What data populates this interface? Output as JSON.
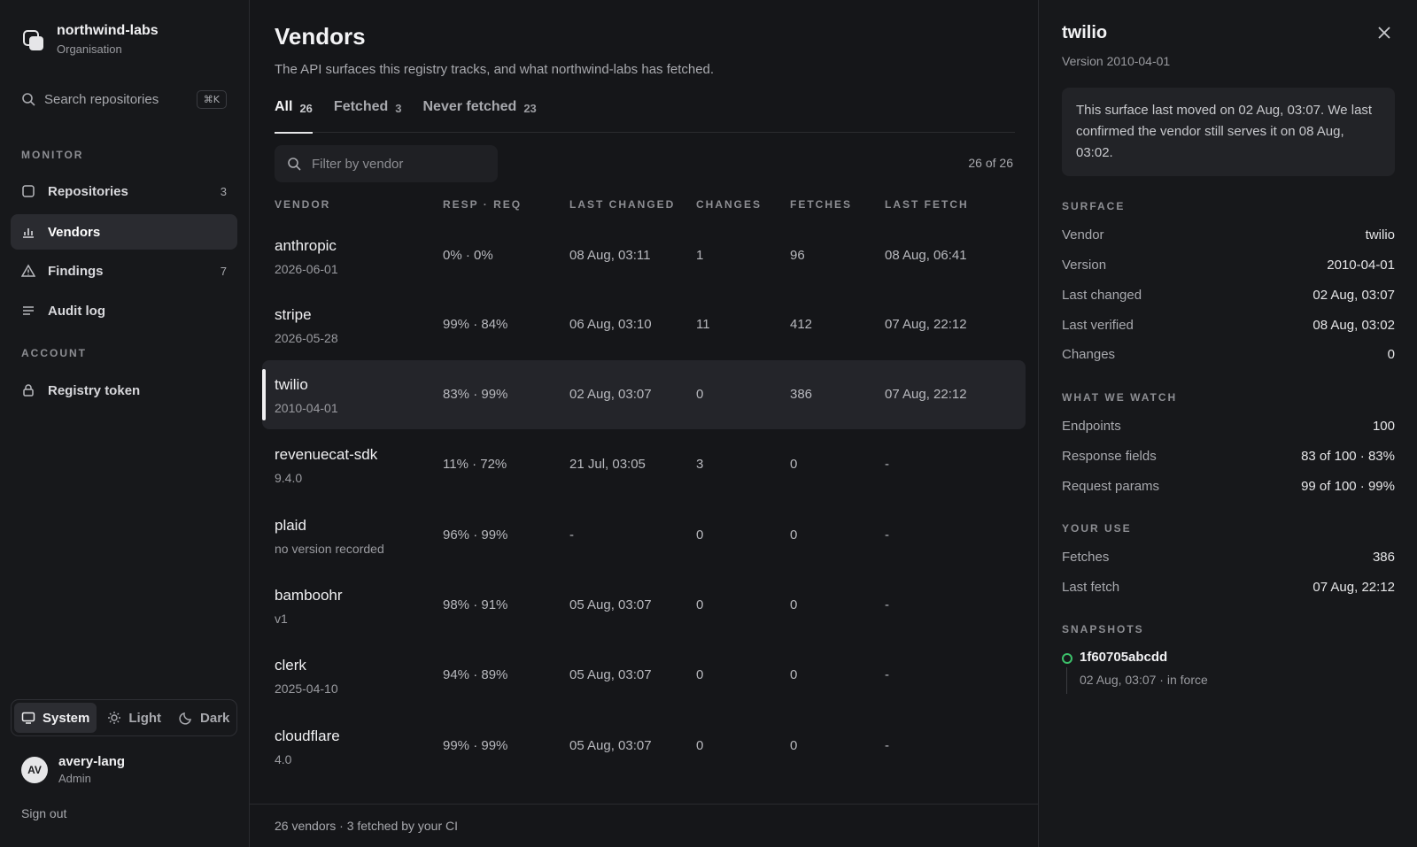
{
  "sidebar": {
    "org_name": "northwind-labs",
    "org_sub": "Organisation",
    "search_label": "Search repositories",
    "search_shortcut": "⌘K",
    "monitor_label": "MONITOR",
    "account_label": "ACCOUNT",
    "items": [
      {
        "label": "Repositories",
        "count": "3",
        "icon": "repo-icon"
      },
      {
        "label": "Vendors",
        "count": "",
        "icon": "chart-icon"
      },
      {
        "label": "Findings",
        "count": "7",
        "icon": "warning-icon"
      },
      {
        "label": "Audit log",
        "count": "",
        "icon": "list-icon"
      }
    ],
    "account_items": [
      {
        "label": "Registry token",
        "icon": "lock-icon"
      }
    ],
    "theme": {
      "system": "System",
      "light": "Light",
      "dark": "Dark",
      "selected": "System"
    },
    "user": {
      "initials": "AV",
      "name": "avery-lang",
      "role": "Admin"
    },
    "sign_out": "Sign out"
  },
  "main": {
    "title": "Vendors",
    "subtitle": "The API surfaces this registry tracks, and what northwind-labs has fetched.",
    "tabs": [
      {
        "label": "All",
        "count": "26"
      },
      {
        "label": "Fetched",
        "count": "3"
      },
      {
        "label": "Never fetched",
        "count": "23"
      }
    ],
    "filter_placeholder": "Filter by vendor",
    "result_count": "26 of 26",
    "columns": [
      "VENDOR",
      "RESP · REQ",
      "LAST CHANGED",
      "CHANGES",
      "FETCHES",
      "LAST FETCH"
    ],
    "rows": [
      {
        "name": "anthropic",
        "version": "2026-06-01",
        "coverage": "0% · 0%",
        "last_changed": "08 Aug, 03:11",
        "changes": "1",
        "fetches": "96",
        "last_fetch": "08 Aug, 06:41"
      },
      {
        "name": "stripe",
        "version": "2026-05-28",
        "coverage": "99% · 84%",
        "last_changed": "06 Aug, 03:10",
        "changes": "11",
        "fetches": "412",
        "last_fetch": "07 Aug, 22:12"
      },
      {
        "name": "twilio",
        "version": "2010-04-01",
        "coverage": "83% · 99%",
        "last_changed": "02 Aug, 03:07",
        "changes": "0",
        "fetches": "386",
        "last_fetch": "07 Aug, 22:12"
      },
      {
        "name": "revenuecat-sdk",
        "version": "9.4.0",
        "coverage": "11% · 72%",
        "last_changed": "21 Jul, 03:05",
        "changes": "3",
        "fetches": "0",
        "last_fetch": "-"
      },
      {
        "name": "plaid",
        "version": "no version recorded",
        "coverage": "96% · 99%",
        "last_changed": "-",
        "changes": "0",
        "fetches": "0",
        "last_fetch": "-"
      },
      {
        "name": "bamboohr",
        "version": "v1",
        "coverage": "98% · 91%",
        "last_changed": "05 Aug, 03:07",
        "changes": "0",
        "fetches": "0",
        "last_fetch": "-"
      },
      {
        "name": "clerk",
        "version": "2025-04-10",
        "coverage": "94% · 89%",
        "last_changed": "05 Aug, 03:07",
        "changes": "0",
        "fetches": "0",
        "last_fetch": "-"
      },
      {
        "name": "cloudflare",
        "version": "4.0",
        "coverage": "99% · 99%",
        "last_changed": "05 Aug, 03:07",
        "changes": "0",
        "fetches": "0",
        "last_fetch": "-"
      }
    ],
    "footer": "26 vendors · 3 fetched by your CI"
  },
  "panel": {
    "title": "twilio",
    "subtitle": "Version 2010-04-01",
    "note": "This surface last moved on 02 Aug, 03:07. We last confirmed the vendor still serves it on 08 Aug, 03:02.",
    "surface_label": "SURFACE",
    "surface": [
      {
        "k": "Vendor",
        "v": "twilio"
      },
      {
        "k": "Version",
        "v": "2010-04-01"
      },
      {
        "k": "Last changed",
        "v": "02 Aug, 03:07"
      },
      {
        "k": "Last verified",
        "v": "08 Aug, 03:02"
      },
      {
        "k": "Changes",
        "v": "0"
      }
    ],
    "watch_label": "WHAT WE WATCH",
    "watch": [
      {
        "k": "Endpoints",
        "v": "100"
      },
      {
        "k": "Response fields",
        "v": "83 of 100 · 83%"
      },
      {
        "k": "Request params",
        "v": "99 of 100 · 99%"
      }
    ],
    "use_label": "YOUR USE",
    "use": [
      {
        "k": "Fetches",
        "v": "386"
      },
      {
        "k": "Last fetch",
        "v": "07 Aug, 22:12"
      }
    ],
    "snapshots_label": "SNAPSHOTS",
    "snapshot": {
      "hash": "1f60705abcdd",
      "meta": "02 Aug, 03:07 · in force",
      "status_color": "#3cc06a"
    }
  }
}
